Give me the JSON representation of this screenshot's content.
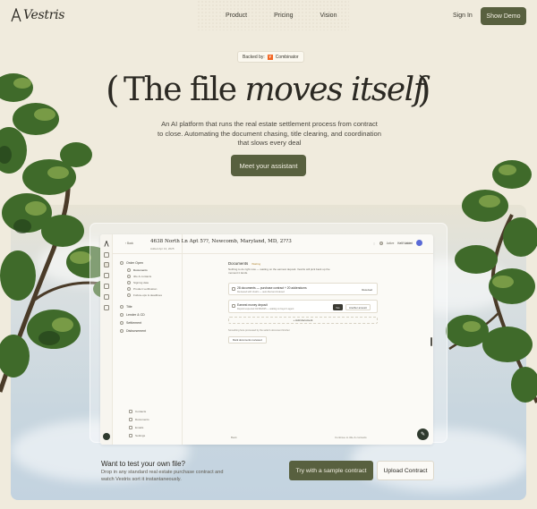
{
  "header": {
    "logo_text": "Vestris",
    "nav": [
      "Product",
      "Pricing",
      "Vision"
    ],
    "signin_label": "Sign In",
    "demo_label": "Show Demo"
  },
  "hero": {
    "backed_label": "Backed by:",
    "backer_icon": "Y",
    "backer_name": "Combinator",
    "paren_left": "(",
    "paren_right": ")",
    "headline_a": "The file ",
    "headline_b": "moves itself",
    "subtitle": "An AI platform that runs the real estate settlement process from contract to close. Automating the document chasing, title clearing, and coordination that slows every deal",
    "cta_label": "Meet your assistant"
  },
  "app": {
    "back_label": "‹ Back",
    "address": "4638 North Ln Apt 5??, Newcomb, Maryland, MD, 2??3",
    "address_sub": "Added Apr 13, 2025",
    "user_status": "Active",
    "user_name": "Kelli Valderi",
    "sidebar": {
      "order_open": "Order Open",
      "sub_items": [
        "Documents",
        "title & contacts",
        "Signing date",
        "Product verification",
        "Follow-ups & deadlines"
      ],
      "groups": [
        "Title",
        "Lender & CD",
        "Settlement",
        "Disbursement"
      ],
      "footer": [
        "Contacts",
        "Documents",
        "Emails",
        "Settings"
      ]
    },
    "main": {
      "section_title": "Documents",
      "section_status": "Waiting",
      "intro": "Nothing to do right now — waiting on the earnest deposit. Vestris will pick back up the moment it lands.",
      "card1_title": "28 documents — purchase contract + 20 addendums",
      "card1_sub": "Reviewed with Vestris — auto-filed and indexed",
      "card1_badge": "Received",
      "card2_title": "Earnest money deposit",
      "card2_sub": "Deposit expected 04/18/2025 — waiting on buyer's agent",
      "card2_btn1": "Yes",
      "card2_btn2": "Another amount",
      "add_label": "+ Add document",
      "follow_text": "Something here processed by the seller's document finisher",
      "mark_label": "Mark documents reviewed",
      "bottom_left": "Back",
      "bottom_right": "Continue to title & contacts"
    },
    "fab_icon": "✎"
  },
  "bottom": {
    "question": "Want to test your own file?",
    "description": "Drop in any standard real estate purchase contract and watch Vestris sort it instantaneously.",
    "try_label": "Try with a sample contract",
    "upload_label": "Upload Contract"
  },
  "colors": {
    "background": "#f0ebdd",
    "accent": "#58603f",
    "sky": "#c3d3e0"
  }
}
